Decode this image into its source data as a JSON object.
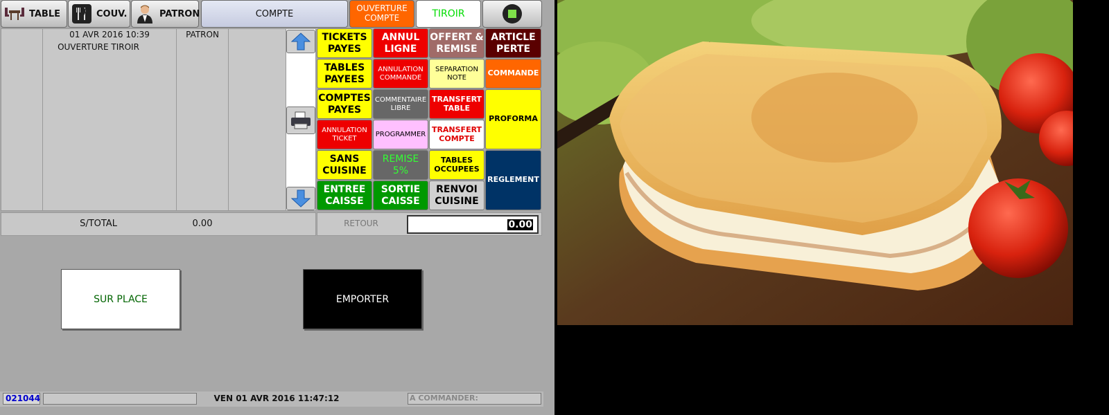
{
  "topbar": {
    "table_label": "TABLE",
    "couv_label": "COUV.",
    "patron_label": "PATRON",
    "compte_label": "COMPTE",
    "ouverture_compte_label": "OUVERTURE COMPTE",
    "tiroir_label": "TIROIR"
  },
  "ticket": {
    "datetime": "01 AVR 2016 10:39",
    "line_label": "OUVERTURE TIROIR",
    "user": "PATRON"
  },
  "grid": {
    "tickets_payes": "TICKETS PAYES",
    "annul_ligne": "ANNUL LIGNE",
    "offert_remise": "OFFERT & REMISE",
    "article_perte": "ARTICLE PERTE",
    "tables_payees": "TABLES PAYEES",
    "annulation_commande": "ANNULATION COMMANDE",
    "separation_note": "SEPARATION NOTE",
    "commande": "COMMANDE",
    "comptes_payes": "COMPTES PAYES",
    "commentaire_libre": "COMMENTAIRE LIBRE",
    "transfert_table": "TRANSFERT TABLE",
    "proforma": "PROFORMA",
    "annulation_ticket": "ANNULATION TICKET",
    "programmer": "PROGRAMMER",
    "transfert_compte": "TRANSFERT COMPTE",
    "sans_cuisine": "SANS CUISINE",
    "remise_5": "REMISE 5%",
    "tables_occupees": "TABLES OCCUPEES",
    "reglement": "REGLEMENT",
    "entree_caisse": "ENTREE CAISSE",
    "sortie_caisse": "SORTIE CAISSE",
    "renvoi_cuisine": "RENVOI CUISINE"
  },
  "totals": {
    "stotal_label": "S/TOTAL",
    "stotal_value": "0.00",
    "retour_label": "RETOUR",
    "amount_value": "0.00"
  },
  "modes": {
    "sur_place": "SUR PLACE",
    "emporter": "EMPORTER"
  },
  "status": {
    "ticket_number": "021044",
    "datetime": "VEN 01 AVR 2016 11:47:12",
    "a_commander_label": "A COMMANDER:"
  },
  "colors": {
    "yellow": "#ffff00",
    "red": "#ee0000",
    "orange": "#ff6600",
    "navy": "#003366",
    "green": "#009900",
    "tiroir_text": "#00dd00",
    "ticket_number": "#0000cc"
  },
  "icons": {
    "table": "table-chairs-icon",
    "couv": "cutlery-icon",
    "patron": "waiter-icon",
    "status": "green-status-icon",
    "scroll_up": "arrow-up-icon",
    "print": "printer-icon",
    "scroll_down": "arrow-down-icon"
  },
  "product_image": "toasted-sandwich-with-tomatoes"
}
